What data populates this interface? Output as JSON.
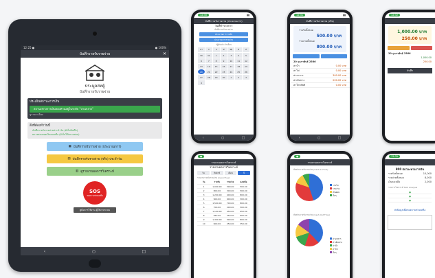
{
  "tablet": {
    "status_left": "12:25 ●",
    "status_right": "● 100%",
    "appbar_title": "บันทึกรายรับรายจ่าย",
    "org_line1": "ประมูลสหผู้",
    "org_line2": "บันทึกรายรับรายจ่าย",
    "dark_panel_title": "ประเมินสถานะการเงิน",
    "green_msg": "สถานะทางการเงินของท่านอยู่ในระดับ \"ปานกลาง\"",
    "dark_panel_sub": "ดูรายละเอียด",
    "light_panel_title": "สิ่งที่ต้องทำวันนี้",
    "light_items": [
      "บันทึกรายรับรายจ่ายประจำวัน (ยังไม่บันทึก)",
      "ตรวจสอบยอดเงินคงเหลือ (ยังไม่ได้ตรวจสอบ)"
    ],
    "btn_income": "บันทึกรายรับรายจ่าย (ประมาณการ)",
    "btn_actual": "บันทึกรายรับรายจ่าย (จริง) ประจำวัน",
    "btn_summary": "ดูรายงานผลการวิเคราะห์",
    "sos_big": "SOS",
    "sos_small": "ขอความช่วยเหลือ",
    "guide": "คู่มือการใช้งาน ผู้ใช้งานระบบ",
    "colors": {
      "frame": "#262a31",
      "bar": "#3a3e46",
      "green": "#3aa64c",
      "blue": "#8fc8f2",
      "yellow": "#f5c842",
      "lightgreen": "#9ad08a",
      "red": "#e02424"
    }
  },
  "phone1": {
    "pill": "12:30",
    "head": "บันทึกรายรับรายจ่าย (ประมาณการ)",
    "title": "วันที่ทำรายการ",
    "sub": "บันทึกรายรับรายจ่าย",
    "btn1": "ประมาณการรายรับ",
    "btn2": "ประมาณการรายจ่าย",
    "section": "ปฏิทินประจำเดือน",
    "days": [
      "อา",
      "จ",
      "อ",
      "พ",
      "พฤ",
      "ศ",
      "ส",
      "30",
      "31",
      "1",
      "2",
      "3",
      "4",
      "5",
      "6",
      "7",
      "8",
      "9",
      "10",
      "11",
      "12",
      "13",
      "14",
      "15",
      "16",
      "17",
      "18",
      "19",
      "20",
      "21",
      "22",
      "23",
      "24",
      "25",
      "26",
      "27",
      "28",
      "29",
      "30",
      "1",
      "2",
      "3",
      "4"
    ]
  },
  "phone2": {
    "pill": "12:31",
    "head": "บันทึกรายรับรายจ่าย (จริง)",
    "label1": "รายรับทั้งหมด",
    "amount1": "500.00 บาท",
    "label2": "รายจ่ายทั้งหมด",
    "amount2": "800.00 บาท",
    "date": "20 กุมภาพันธ์ 2566",
    "rows": [
      [
        "ค่าน้ำ",
        "0.00 บาท"
      ],
      [
        "ค่าไฟ",
        "0.00 บาท"
      ],
      [
        "ค่าอาหาร",
        "300.00 บาท"
      ],
      [
        "ค่าเดินทาง",
        "200.00 บาท"
      ],
      [
        "ค่าโทรศัพท์",
        "0.00 บาท"
      ]
    ]
  },
  "phone3": {
    "pill": "12:32",
    "amount1": "1,000.00 บาท",
    "amount2": "250.00 บาท",
    "date": "20 กุมภาพันธ์ 2566",
    "row1": "1,000.00",
    "row2": "250.00",
    "footer": "บันทึก"
  },
  "phone4": {
    "head": "รายงานผลการวิเคราะห์",
    "title": "รายงานผลการวิเคราะห์",
    "tabs": [
      "วัน",
      "สัปดาห์",
      "เดือน",
      "ปี"
    ],
    "table_title": "รายงานรายรับรายจ่าย (Cash Flow)",
    "cols": [
      "วัน",
      "รายรับ",
      "รายจ่าย",
      "คงเหลือ"
    ],
    "rows": [
      [
        "1",
        "1,000.00",
        "500.00",
        "500.00"
      ],
      [
        "2",
        "800.00",
        "300.00",
        "500.00"
      ],
      [
        "3",
        "1,200.00",
        "400.00",
        "800.00"
      ],
      [
        "4",
        "900.00",
        "600.00",
        "300.00"
      ],
      [
        "5",
        "1,500.00",
        "700.00",
        "800.00"
      ],
      [
        "6",
        "700.00",
        "200.00",
        "500.00"
      ],
      [
        "7",
        "1,100.00",
        "450.00",
        "650.00"
      ],
      [
        "8",
        "950.00",
        "350.00",
        "600.00"
      ],
      [
        "9",
        "1,300.00",
        "500.00",
        "800.00"
      ],
      [
        "10",
        "600.00",
        "250.00",
        "350.00"
      ]
    ]
  },
  "phone5": {
    "head": "รายงานผลการวิเคราะห์",
    "chart1_title": "สัดส่วนรายรับรายจ่าย (Cash In Flow)",
    "chart2_title": "สัดส่วนรายรับรายจ่าย (Cash Out Flow)",
    "legend1": [
      "รายรับ",
      "รายจ่าย",
      "เงินออม",
      "อื่นๆ"
    ],
    "legend2": [
      "ค่าอาหาร",
      "ค่าเดินทาง",
      "ค่าน้ำ",
      "ค่าไฟ",
      "อื่นๆ"
    ]
  },
  "phone6": {
    "pill": "12:35",
    "amount": "800 สถานะทางการเงิน",
    "rows": [
      [
        "รายรับทั้งหมด",
        "10,000"
      ],
      [
        "รายจ่ายทั้งหมด",
        "8,000"
      ],
      [
        "เงินคงเหลือ",
        "2,000"
      ]
    ],
    "section": "รายการวิเคราะห์ SOS Analysis",
    "footer": "ส่งข้อมูลเพื่อขอความช่วยเหลือ"
  }
}
